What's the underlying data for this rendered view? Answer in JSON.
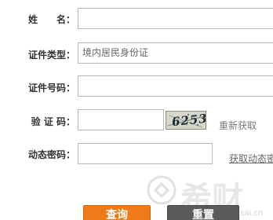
{
  "form": {
    "name_label": "姓　　名：",
    "id_type_label": "证件类型：",
    "id_type_value": "境内居民身份证",
    "id_number_label": "证件号码：",
    "captcha_label": "验 证 码：",
    "captcha_image_text": "6253",
    "refresh_captcha_label": "重新获取",
    "dynamic_password_label": "动态密码：",
    "get_dynamic_password_label": "获取动态密"
  },
  "buttons": {
    "query_label": "查询",
    "reset_label": "重置"
  },
  "watermark": {
    "brand": "希财",
    "url": "www.csai.cn"
  },
  "colors": {
    "query_button": "#ef7a1a",
    "reset_button": "#5b5b5b",
    "field_border": "#b8b8b8"
  }
}
